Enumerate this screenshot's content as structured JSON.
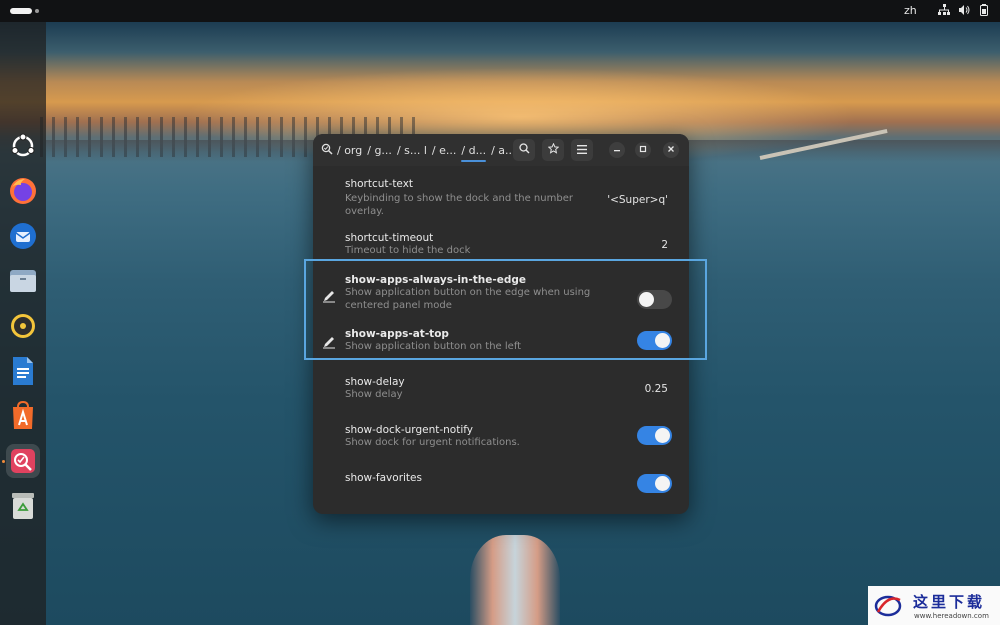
{
  "topbar": {
    "language": "zh",
    "icons": [
      "network-icon",
      "volume-icon",
      "battery-icon"
    ]
  },
  "dock": {
    "apps": [
      {
        "name": "ubuntu-logo-icon"
      },
      {
        "name": "firefox-icon"
      },
      {
        "name": "thunderbird-icon"
      },
      {
        "name": "files-icon"
      },
      {
        "name": "rhythmbox-icon"
      },
      {
        "name": "libreoffice-writer-icon"
      },
      {
        "name": "app-center-icon"
      },
      {
        "name": "dconf-editor-icon",
        "active": true
      },
      {
        "name": "trash-icon"
      }
    ]
  },
  "window": {
    "path": {
      "segments": [
        "/ org",
        "/ g...",
        "/ s... l",
        "/ e...",
        "/ d...",
        "/ a..."
      ],
      "current_index": 4
    },
    "rows": [
      {
        "key": "shortcut-text",
        "description": "Keybinding to show the dock and the number overlay.",
        "value": "'<Super>q'",
        "type": "value"
      },
      {
        "key": "shortcut-timeout",
        "description": "Timeout to hide the dock",
        "value": "2",
        "type": "value"
      },
      {
        "key": "show-apps-always-in-the-edge",
        "description": "Show application button on the edge when using centered panel mode",
        "type": "toggle",
        "on": false,
        "modified": true
      },
      {
        "key": "show-apps-at-top",
        "description": "Show application button on the left",
        "type": "toggle",
        "on": true,
        "modified": true
      },
      {
        "key": "show-delay",
        "description": "Show delay",
        "value": "0.25",
        "type": "value"
      },
      {
        "key": "show-dock-urgent-notify",
        "description": "Show dock for urgent notifications.",
        "type": "toggle",
        "on": true
      },
      {
        "key": "show-favorites",
        "description": "",
        "type": "toggle",
        "on": true
      }
    ]
  },
  "watermark": {
    "title": "这里下载",
    "url": "www.hereadown.com"
  },
  "colors": {
    "accent": "#3584e4",
    "highlight_box": "#5aa6e0"
  }
}
